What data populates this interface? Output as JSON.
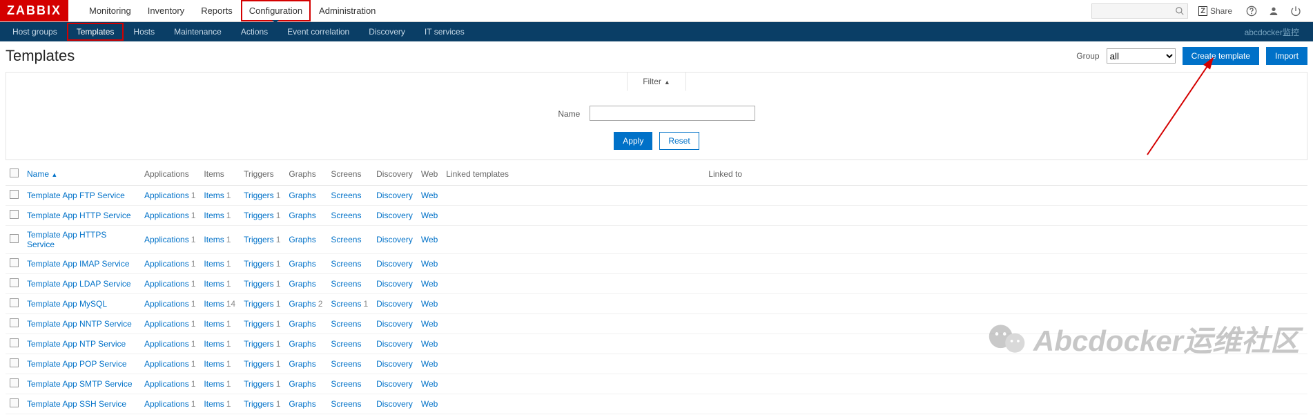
{
  "brand": "ZABBIX",
  "topnav": {
    "items": [
      {
        "label": "Monitoring"
      },
      {
        "label": "Inventory"
      },
      {
        "label": "Reports"
      },
      {
        "label": "Configuration",
        "active": true
      },
      {
        "label": "Administration"
      }
    ],
    "share_label": "Share"
  },
  "subnav": {
    "items": [
      {
        "label": "Host groups"
      },
      {
        "label": "Templates",
        "active": true
      },
      {
        "label": "Hosts"
      },
      {
        "label": "Maintenance"
      },
      {
        "label": "Actions"
      },
      {
        "label": "Event correlation"
      },
      {
        "label": "Discovery"
      },
      {
        "label": "IT services"
      }
    ],
    "right_text": "abcdocker",
    "right_link": "监控"
  },
  "page": {
    "title": "Templates",
    "group_label": "Group",
    "group_value": "all",
    "create_btn": "Create template",
    "import_btn": "Import"
  },
  "filter": {
    "tab_label": "Filter",
    "name_label": "Name",
    "name_value": "",
    "apply_label": "Apply",
    "reset_label": "Reset"
  },
  "table": {
    "headers": {
      "name": "Name",
      "applications": "Applications",
      "items": "Items",
      "triggers": "Triggers",
      "graphs": "Graphs",
      "screens": "Screens",
      "discovery": "Discovery",
      "web": "Web",
      "linked_templates": "Linked templates",
      "linked_to": "Linked to"
    },
    "rows": [
      {
        "name": "Template App FTP Service",
        "applications": "Applications",
        "app_cnt": "1",
        "items": "Items",
        "items_cnt": "1",
        "triggers": "Triggers",
        "trig_cnt": "1",
        "graphs": "Graphs",
        "graphs_cnt": "",
        "screens": "Screens",
        "scr_cnt": "",
        "discovery": "Discovery",
        "web": "Web"
      },
      {
        "name": "Template App HTTP Service",
        "applications": "Applications",
        "app_cnt": "1",
        "items": "Items",
        "items_cnt": "1",
        "triggers": "Triggers",
        "trig_cnt": "1",
        "graphs": "Graphs",
        "graphs_cnt": "",
        "screens": "Screens",
        "scr_cnt": "",
        "discovery": "Discovery",
        "web": "Web"
      },
      {
        "name": "Template App HTTPS Service",
        "applications": "Applications",
        "app_cnt": "1",
        "items": "Items",
        "items_cnt": "1",
        "triggers": "Triggers",
        "trig_cnt": "1",
        "graphs": "Graphs",
        "graphs_cnt": "",
        "screens": "Screens",
        "scr_cnt": "",
        "discovery": "Discovery",
        "web": "Web"
      },
      {
        "name": "Template App IMAP Service",
        "applications": "Applications",
        "app_cnt": "1",
        "items": "Items",
        "items_cnt": "1",
        "triggers": "Triggers",
        "trig_cnt": "1",
        "graphs": "Graphs",
        "graphs_cnt": "",
        "screens": "Screens",
        "scr_cnt": "",
        "discovery": "Discovery",
        "web": "Web"
      },
      {
        "name": "Template App LDAP Service",
        "applications": "Applications",
        "app_cnt": "1",
        "items": "Items",
        "items_cnt": "1",
        "triggers": "Triggers",
        "trig_cnt": "1",
        "graphs": "Graphs",
        "graphs_cnt": "",
        "screens": "Screens",
        "scr_cnt": "",
        "discovery": "Discovery",
        "web": "Web"
      },
      {
        "name": "Template App MySQL",
        "applications": "Applications",
        "app_cnt": "1",
        "items": "Items",
        "items_cnt": "14",
        "triggers": "Triggers",
        "trig_cnt": "1",
        "graphs": "Graphs",
        "graphs_cnt": "2",
        "screens": "Screens",
        "scr_cnt": "1",
        "discovery": "Discovery",
        "web": "Web"
      },
      {
        "name": "Template App NNTP Service",
        "applications": "Applications",
        "app_cnt": "1",
        "items": "Items",
        "items_cnt": "1",
        "triggers": "Triggers",
        "trig_cnt": "1",
        "graphs": "Graphs",
        "graphs_cnt": "",
        "screens": "Screens",
        "scr_cnt": "",
        "discovery": "Discovery",
        "web": "Web"
      },
      {
        "name": "Template App NTP Service",
        "applications": "Applications",
        "app_cnt": "1",
        "items": "Items",
        "items_cnt": "1",
        "triggers": "Triggers",
        "trig_cnt": "1",
        "graphs": "Graphs",
        "graphs_cnt": "",
        "screens": "Screens",
        "scr_cnt": "",
        "discovery": "Discovery",
        "web": "Web"
      },
      {
        "name": "Template App POP Service",
        "applications": "Applications",
        "app_cnt": "1",
        "items": "Items",
        "items_cnt": "1",
        "triggers": "Triggers",
        "trig_cnt": "1",
        "graphs": "Graphs",
        "graphs_cnt": "",
        "screens": "Screens",
        "scr_cnt": "",
        "discovery": "Discovery",
        "web": "Web"
      },
      {
        "name": "Template App SMTP Service",
        "applications": "Applications",
        "app_cnt": "1",
        "items": "Items",
        "items_cnt": "1",
        "triggers": "Triggers",
        "trig_cnt": "1",
        "graphs": "Graphs",
        "graphs_cnt": "",
        "screens": "Screens",
        "scr_cnt": "",
        "discovery": "Discovery",
        "web": "Web"
      },
      {
        "name": "Template App SSH Service",
        "applications": "Applications",
        "app_cnt": "1",
        "items": "Items",
        "items_cnt": "1",
        "triggers": "Triggers",
        "trig_cnt": "1",
        "graphs": "Graphs",
        "graphs_cnt": "",
        "screens": "Screens",
        "scr_cnt": "",
        "discovery": "Discovery",
        "web": "Web"
      }
    ]
  },
  "watermark": "Abcdocker运维社区"
}
